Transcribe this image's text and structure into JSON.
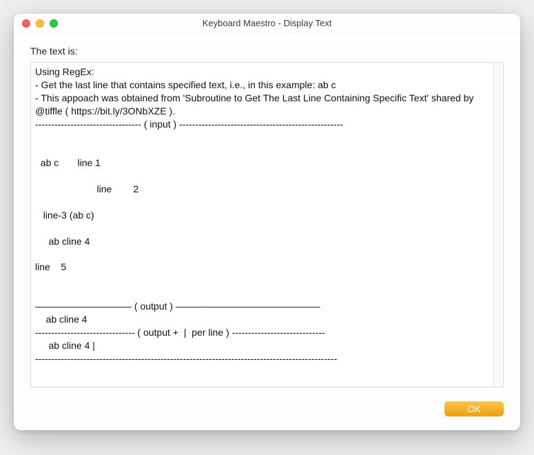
{
  "window": {
    "title": "Keyboard Maestro - Display Text"
  },
  "label": "The text is:",
  "text_content": "Using RegEx:\n- Get the last line that contains specified text, i.e., in this example: ab c\n- This appoach was obtained from 'Subroutine to Get The Last Line Containing Specific Text' shared by @tiffle ( https://bit.ly/3ONbXZE ).\n--------------------------------- ( input ) ---------------------------------------------------\n\n\n  ab c       line 1\n\n                       line        2\n\n   line-3 (ab c)\n\n     ab cline 4\n\nline    5\n\n\n—————————— ( output ) ———————————————\n    ab cline 4\n------------------------------- ( output +  |  per line ) -----------------------------\n     ab cline 4 |\n----------------------------------------------------------------------------------------------",
  "buttons": {
    "ok": "OK"
  }
}
